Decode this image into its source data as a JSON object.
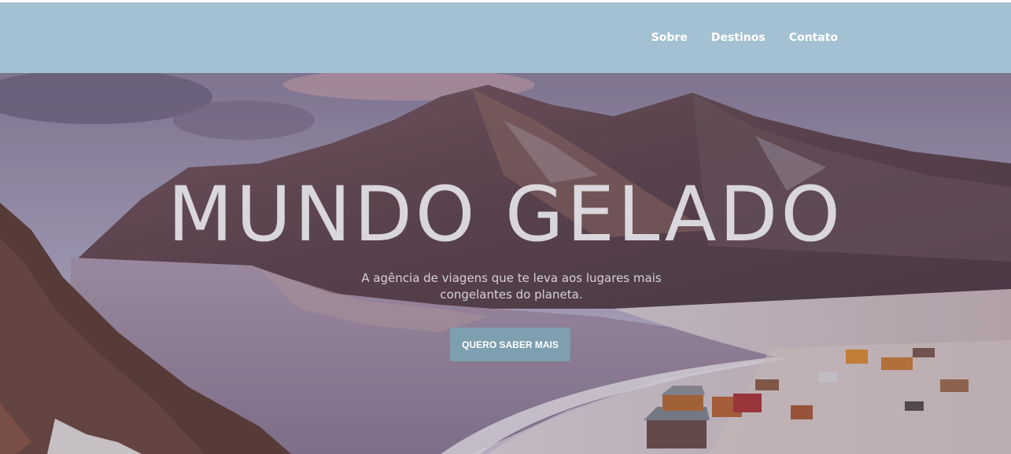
{
  "nav": {
    "items": [
      {
        "label": "Sobre"
      },
      {
        "label": "Destinos"
      },
      {
        "label": "Contato"
      }
    ]
  },
  "hero": {
    "title": "MUNDO GELADO",
    "subtitle": "A agência de viagens que te leva aos lugares mais congelantes do planeta.",
    "cta_label": "QUERO SABER MAIS",
    "image_subject": "frozen lake bay with snowy mountains and village at sunset"
  },
  "colors": {
    "navbar": "#a3c1d2",
    "nav_text": "#ffffff",
    "cta_bg": "#7e9faf",
    "cta_text": "#ffffff"
  }
}
